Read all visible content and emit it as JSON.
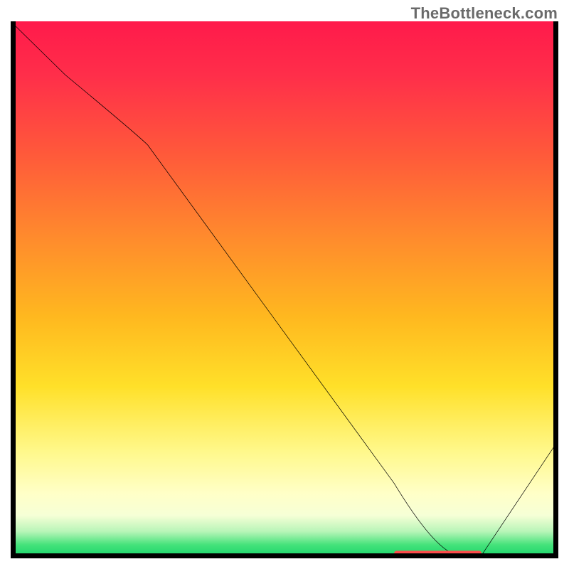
{
  "watermark": "TheBottleneck.com",
  "chart_data": {
    "type": "line",
    "title": "",
    "xlabel": "",
    "ylabel": "",
    "xlim": [
      0,
      100
    ],
    "ylim": [
      0,
      100
    ],
    "grid": false,
    "legend": false,
    "background_gradient": {
      "direction": "vertical",
      "stops": [
        {
          "pos": 0.0,
          "color": "#ff1a4b"
        },
        {
          "pos": 0.25,
          "color": "#ff5a3a"
        },
        {
          "pos": 0.55,
          "color": "#ffb81f"
        },
        {
          "pos": 0.8,
          "color": "#fff88a"
        },
        {
          "pos": 0.93,
          "color": "#f0ffd0"
        },
        {
          "pos": 1.0,
          "color": "#15d46a"
        }
      ]
    },
    "series": [
      {
        "name": "curve",
        "color": "#000000",
        "x": [
          0,
          10,
          25,
          50,
          70,
          82,
          100
        ],
        "values": [
          100,
          90,
          77,
          42,
          14,
          0,
          22
        ]
      }
    ],
    "marker": {
      "name": "optimal-range",
      "color": "#ff4a4a",
      "x_range": [
        70,
        86
      ],
      "y": 0
    }
  }
}
